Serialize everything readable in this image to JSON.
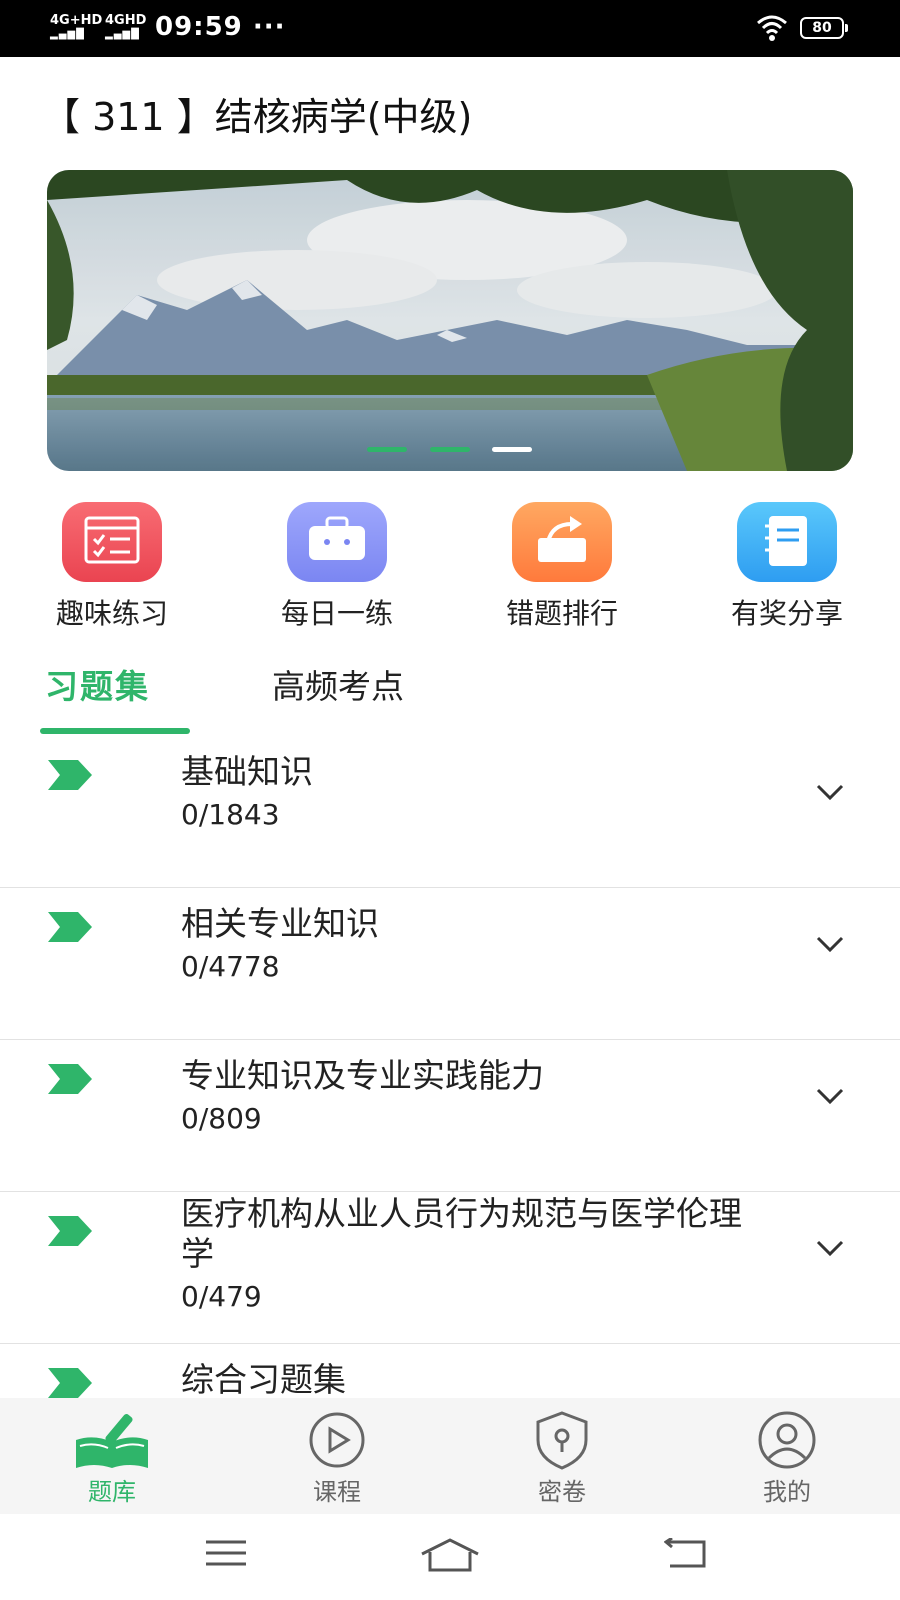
{
  "status_bar": {
    "signal1": "4G+HD",
    "signal2": "4GHD",
    "time": "09:59",
    "more": "···",
    "battery": "80"
  },
  "page_title": "【 311 】结核病学(中级)",
  "banner": {
    "active_dot": 1,
    "dot_count": 3,
    "accent": "#2fb56a"
  },
  "quick_actions": [
    {
      "label": "趣味练习",
      "icon": "worksheet-icon",
      "color_from": "#f86c73",
      "color_to": "#ea4451"
    },
    {
      "label": "每日一练",
      "icon": "toolbox-icon",
      "color_from": "#9ea7fc",
      "color_to": "#7b86f2"
    },
    {
      "label": "错题排行",
      "icon": "share-box-icon",
      "color_from": "#ffa861",
      "color_to": "#ff7a3c"
    },
    {
      "label": "有奖分享",
      "icon": "notebook-icon",
      "color_from": "#5ac8fb",
      "color_to": "#2e9df1"
    }
  ],
  "tabs": {
    "active": "习题集",
    "inactive": "高频考点"
  },
  "list": [
    {
      "title": "基础知识",
      "count": "0/1843"
    },
    {
      "title": "相关专业知识",
      "count": "0/4778"
    },
    {
      "title": "专业知识及专业实践能力",
      "count": "0/809"
    },
    {
      "title": "医疗机构从业人员行为规范与医学伦理学",
      "count": "0/479"
    },
    {
      "title": "综合习题集",
      "count": ""
    }
  ],
  "tab_bar": [
    {
      "label": "题库",
      "icon": "book-pen-icon",
      "active": true
    },
    {
      "label": "课程",
      "icon": "play-circle-icon",
      "active": false
    },
    {
      "label": "密卷",
      "icon": "lock-shield-icon",
      "active": false
    },
    {
      "label": "我的",
      "icon": "user-circle-icon",
      "active": false
    }
  ],
  "colors": {
    "accent": "#2fb56a",
    "divider": "#e2e2e2",
    "tabbar_bg": "#f5f5f5"
  }
}
